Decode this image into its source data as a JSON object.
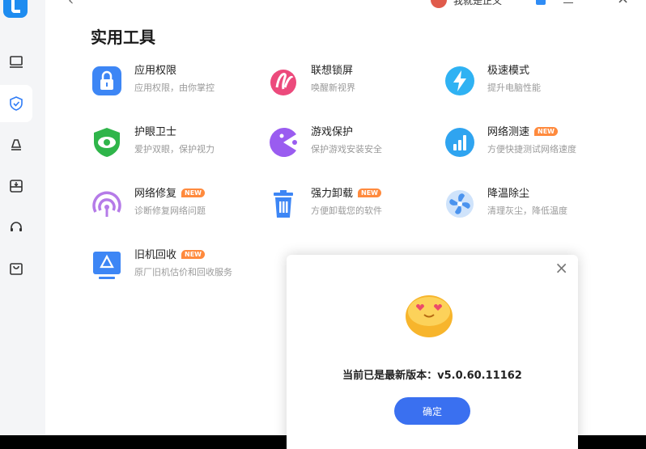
{
  "titlebar": {
    "user_name": "我就是正义"
  },
  "page": {
    "title": "实用工具"
  },
  "tools": [
    {
      "name": "应用权限",
      "desc": "应用权限，由你掌控",
      "badge": ""
    },
    {
      "name": "联想锁屏",
      "desc": "唤醒新视界",
      "badge": ""
    },
    {
      "name": "极速模式",
      "desc": "提升电脑性能",
      "badge": ""
    },
    {
      "name": "护眼卫士",
      "desc": "爱护双眼，保护视力",
      "badge": ""
    },
    {
      "name": "游戏保护",
      "desc": "保护游戏安装安全",
      "badge": ""
    },
    {
      "name": "网络测速",
      "desc": "方便快捷测试网络速度",
      "badge": "NEW"
    },
    {
      "name": "网络修复",
      "desc": "诊断修复网络问题",
      "badge": "NEW"
    },
    {
      "name": "强力卸载",
      "desc": "方便卸载您的软件",
      "badge": "NEW"
    },
    {
      "name": "降温除尘",
      "desc": "清理灰尘，降低温度",
      "badge": ""
    },
    {
      "name": "旧机回收",
      "desc": "原厂旧机估价和回收服务",
      "badge": "NEW"
    }
  ],
  "dialog": {
    "message": "当前已是最新版本：v5.0.60.11162",
    "confirm_label": "确定"
  },
  "colors": {
    "accent": "#3a70f0",
    "badge": "#ff8a3d"
  }
}
